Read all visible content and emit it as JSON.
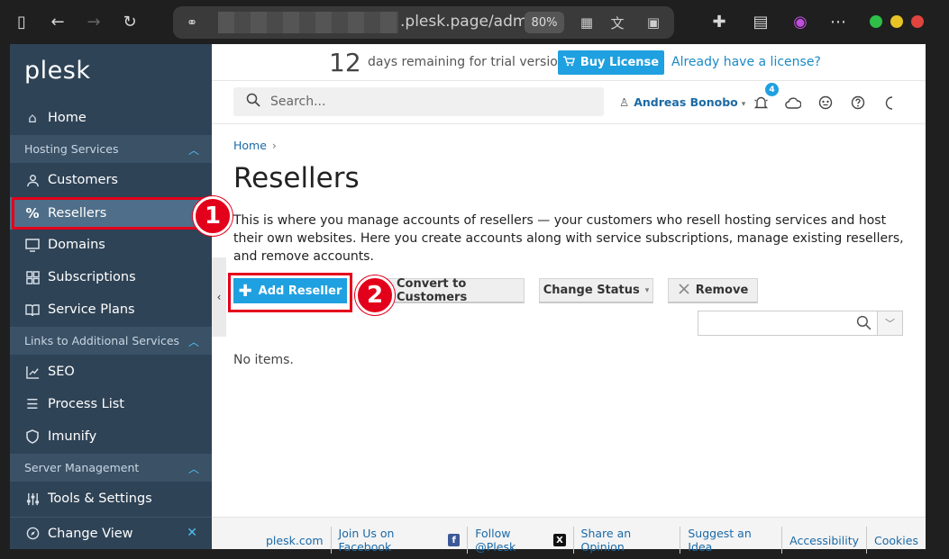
{
  "browser": {
    "url_host": ".plesk.page/adm",
    "zoom": "80%"
  },
  "sidebar": {
    "logo": "plesk",
    "home": "Home",
    "sections": [
      {
        "label": "Hosting Services"
      },
      {
        "label": "Links to Additional Services"
      },
      {
        "label": "Server Management"
      }
    ],
    "items": {
      "customers": "Customers",
      "resellers": "Resellers",
      "domains": "Domains",
      "subscriptions": "Subscriptions",
      "service_plans": "Service Plans",
      "seo": "SEO",
      "process_list": "Process List",
      "imunify": "Imunify",
      "tools_settings": "Tools & Settings",
      "change_view": "Change View"
    }
  },
  "trial": {
    "days": "12",
    "text": "days remaining for trial version",
    "buy_label": "Buy License",
    "have_license": "Already have a license?"
  },
  "header": {
    "search_placeholder": "Search...",
    "user_name": "Andreas Bonobo",
    "notification_count": "4"
  },
  "main": {
    "breadcrumb_home": "Home",
    "title": "Resellers",
    "description": "This is where you manage accounts of resellers — your customers who resell hosting services and host their own websites. Here you create accounts along with service subscriptions, manage existing resellers, and remove accounts.",
    "buttons": {
      "add": "Add Reseller",
      "convert": "Convert to Customers",
      "change_status": "Change Status",
      "remove": "Remove"
    },
    "empty": "No items."
  },
  "markers": {
    "one": "1",
    "two": "2"
  },
  "footer": {
    "links": [
      "plesk.com",
      "Join Us on Facebook",
      "Follow @Plesk",
      "Share an Opinion",
      "Suggest an Idea",
      "Accessibility",
      "Cookies"
    ]
  },
  "colors": {
    "sidebar_bg": "#2f4356",
    "accent": "#1fa0e0",
    "highlight": "#e3001b"
  }
}
